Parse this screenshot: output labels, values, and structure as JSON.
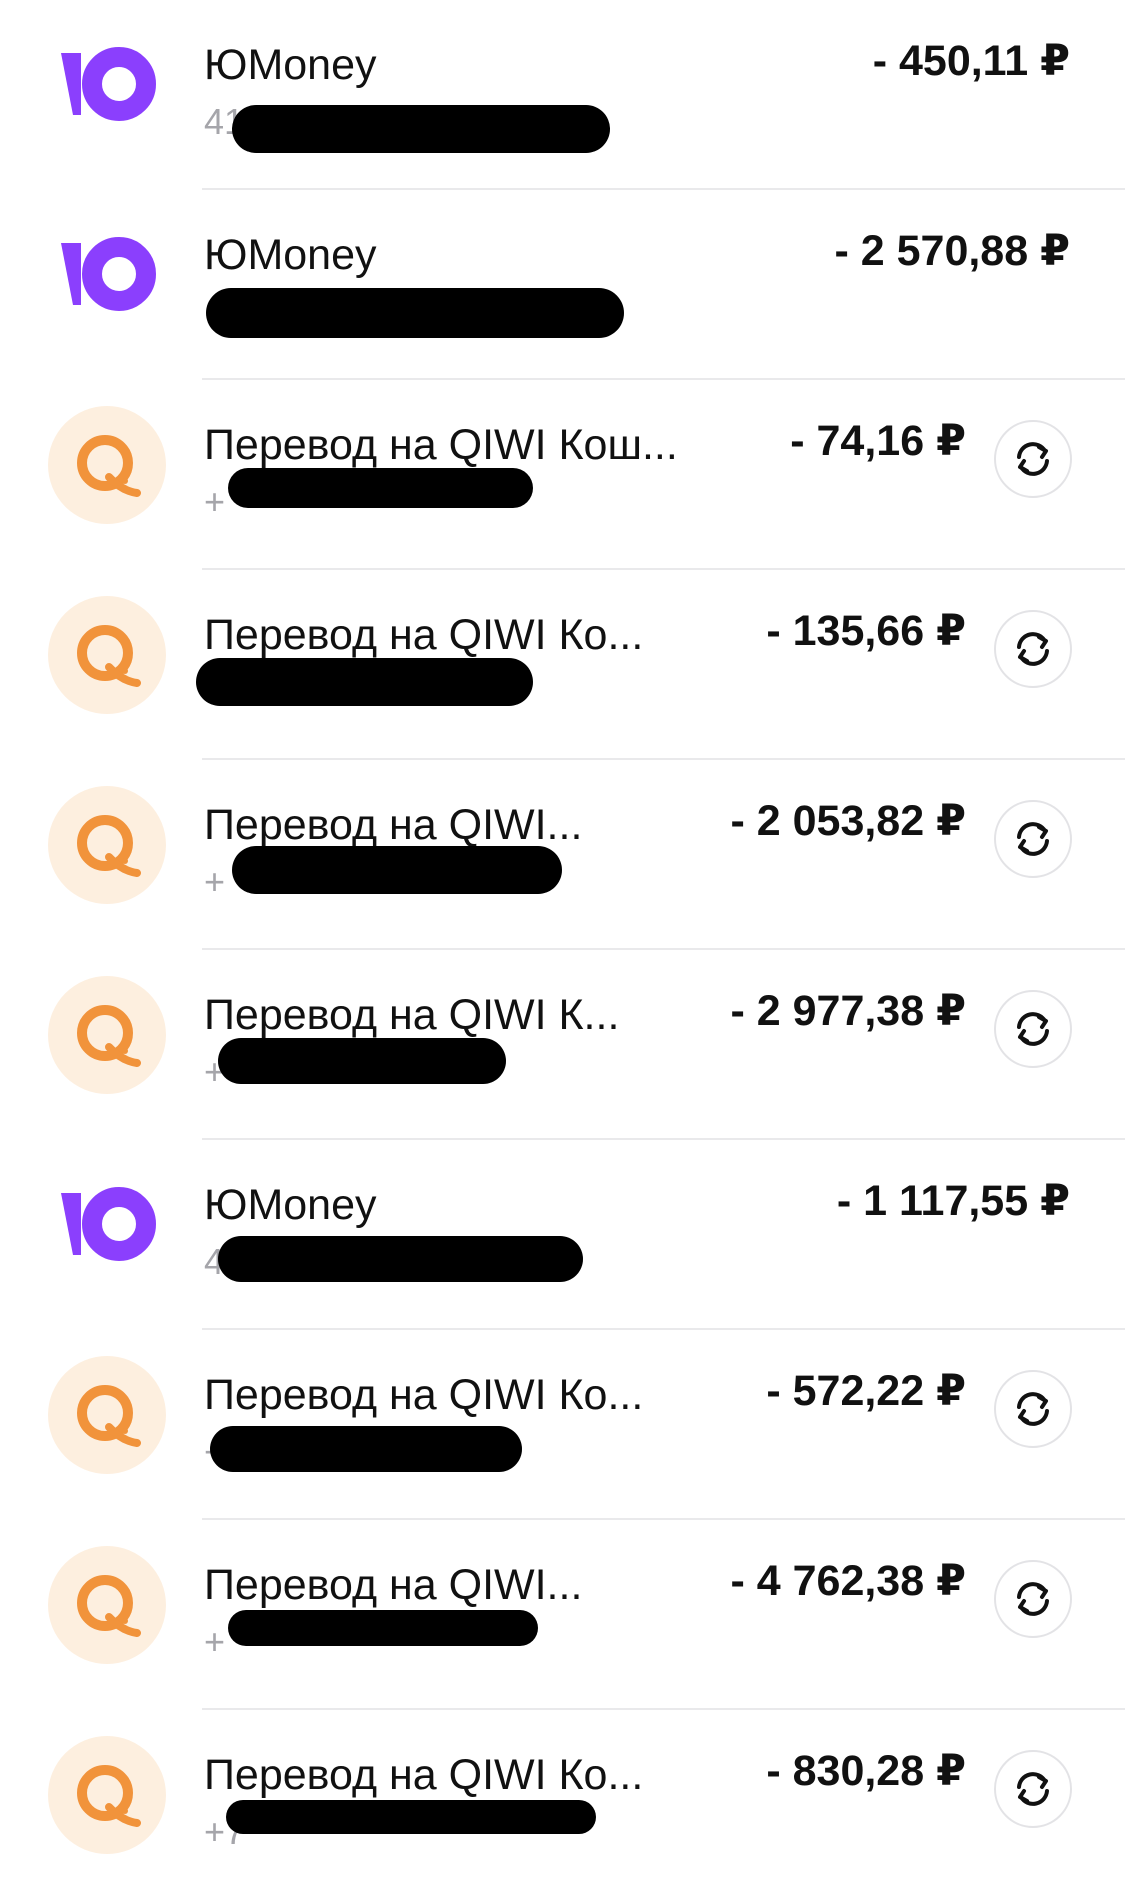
{
  "colors": {
    "yoomoney_brand": "#8b3ffd",
    "qiwi_orange": "#f1933b",
    "qiwi_bg": "#fdefdf"
  },
  "operations": [
    {
      "provider": "yoomoney",
      "title": "ЮMoney",
      "subtitle": "41",
      "amount": "- 450,11 ₽",
      "repeat": false
    },
    {
      "provider": "yoomoney",
      "title": "ЮMoney",
      "subtitle": "",
      "amount": "- 2 570,88 ₽",
      "repeat": false
    },
    {
      "provider": "qiwi",
      "title": "Перевод на QIWI Кош...",
      "subtitle": "+",
      "amount": "- 74,16 ₽",
      "repeat": true
    },
    {
      "provider": "qiwi",
      "title": "Перевод на QIWI Ко...",
      "subtitle": "+",
      "amount": "- 135,66 ₽",
      "repeat": true
    },
    {
      "provider": "qiwi",
      "title": "Перевод на QIWI...",
      "subtitle": "+",
      "amount": "- 2 053,82 ₽",
      "repeat": true
    },
    {
      "provider": "qiwi",
      "title": "Перевод на QIWI К...",
      "subtitle": "+",
      "amount": "- 2 977,38 ₽",
      "repeat": true
    },
    {
      "provider": "yoomoney",
      "title": "ЮMoney",
      "subtitle": "4",
      "amount": "- 1 117,55 ₽",
      "repeat": false
    },
    {
      "provider": "qiwi",
      "title": "Перевод на QIWI Ко...",
      "subtitle": "+",
      "amount": "- 572,22 ₽",
      "repeat": true
    },
    {
      "provider": "qiwi",
      "title": "Перевод на QIWI...",
      "subtitle": "+",
      "amount": "- 4 762,38 ₽",
      "repeat": true
    },
    {
      "provider": "qiwi",
      "title": "Перевод на QIWI Ко...",
      "subtitle": "+7",
      "amount": "- 830,28 ₽",
      "repeat": true
    }
  ],
  "icons": {
    "yoomoney": "yoomoney-logo-icon",
    "qiwi": "qiwi-logo-icon",
    "repeat": "repeat-icon"
  }
}
